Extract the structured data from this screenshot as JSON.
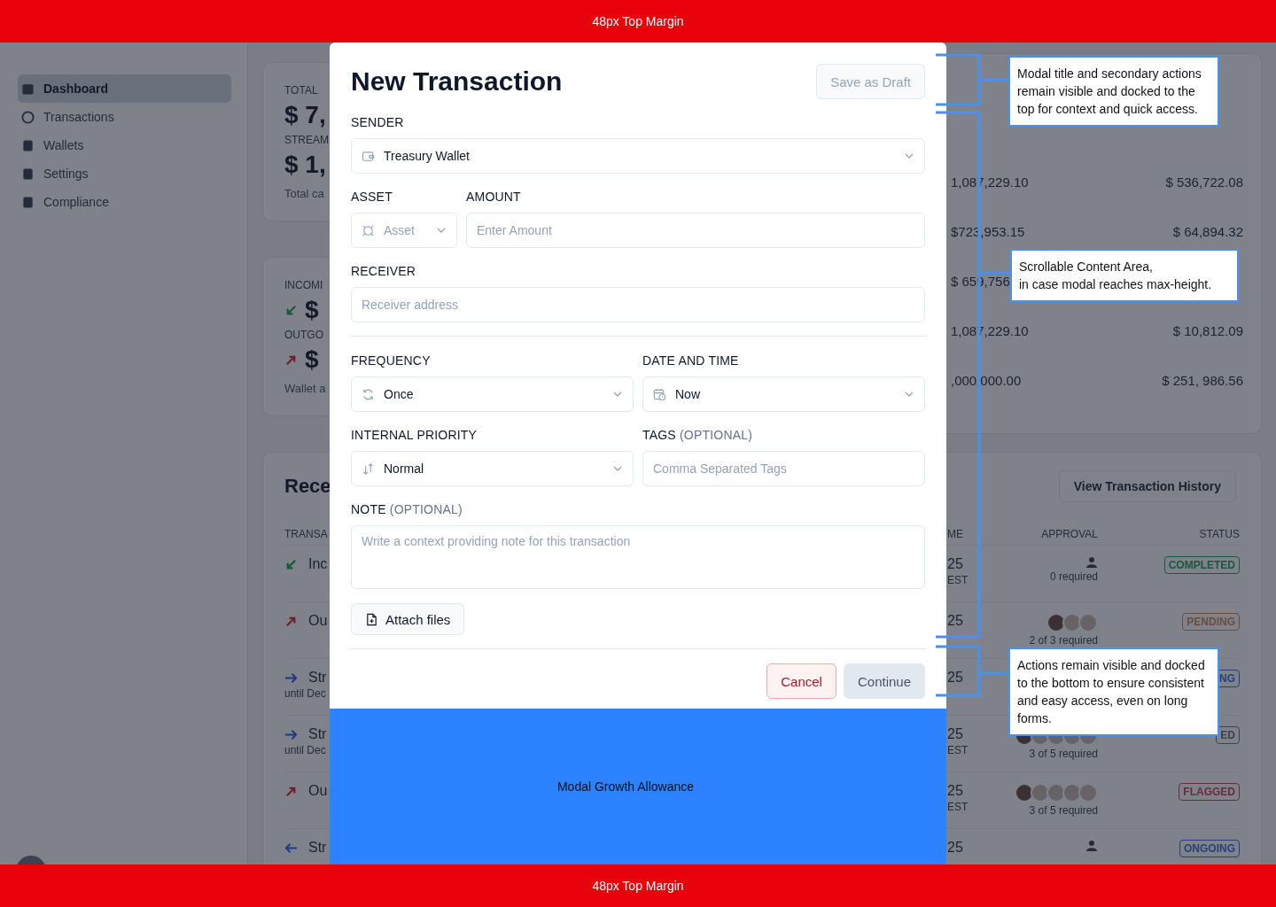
{
  "margins": {
    "top": {
      "label": "48px Top Margin"
    },
    "bottom": {
      "label": "48px Top Margin"
    }
  },
  "background": {
    "sidebar": {
      "items": [
        {
          "label": "Dashboard",
          "kind": "calendar",
          "selected": true
        },
        {
          "label": "Transactions",
          "kind": "coin",
          "selected": false
        },
        {
          "label": "Wallets",
          "kind": "document",
          "selected": false
        },
        {
          "label": "Settings",
          "kind": "document",
          "selected": false
        },
        {
          "label": "Compliance",
          "kind": "document",
          "selected": false
        }
      ]
    },
    "summary_card": {
      "lines": [
        {
          "kind": "label",
          "text": "TOTAL"
        },
        {
          "kind": "amount",
          "text": "$ 7,"
        },
        {
          "kind": "label",
          "text": "STREAM"
        },
        {
          "kind": "amount",
          "text": "$ 1,"
        },
        {
          "kind": "note",
          "text": "Total ca"
        }
      ]
    },
    "flow_card": {
      "lines": [
        {
          "kind": "label",
          "text": "INCOMI"
        },
        {
          "kind": "amount_in",
          "text": "$"
        },
        {
          "kind": "label",
          "text": "OUTGO"
        },
        {
          "kind": "amount_out",
          "text": "$"
        },
        {
          "kind": "note",
          "text": "Wallet a"
        }
      ]
    },
    "balance_table": {
      "rows": [
        {
          "balance": "1,087,229.10",
          "streaming": "$ 536,722.08"
        },
        {
          "balance": "$723,953.15",
          "streaming": "$ 64,894.32"
        },
        {
          "balance": "$ 659,756"
        },
        {
          "balance": "1,087,229.10",
          "streaming": "$ 10,812.09"
        },
        {
          "balance": ",000,000.00",
          "streaming": "$ 251, 986.56"
        }
      ]
    },
    "recent_card": {
      "title": "Rece",
      "history_button": "View Transaction History",
      "columns": [
        "TRANSA",
        "ME",
        "APPROVAL",
        "STATUS"
      ],
      "rows": [
        {
          "kind": "in",
          "name": "Inc",
          "time": "25",
          "zone": "EST",
          "approval": {
            "kind": "person",
            "text": "0 required"
          },
          "status": {
            "label": "COMPLETED",
            "kind": "success"
          }
        },
        {
          "kind": "out",
          "name": "Ou",
          "time": "25",
          "approval": {
            "kind": "avatars",
            "avatars": [
              {
                "kind": "dark"
              },
              {
                "kind": "light"
              },
              {
                "kind": "light"
              }
            ],
            "text": "2 of 3 required"
          },
          "status": {
            "label": "PENDING",
            "kind": "warning"
          }
        },
        {
          "kind": "stream",
          "name": "Str",
          "sub": "until Dec",
          "time": "25",
          "status": {
            "label": "NG",
            "kind": "info"
          }
        },
        {
          "kind": "stream",
          "name": "Str",
          "sub": "until Dec",
          "time": "25",
          "zone": "EST",
          "approval": {
            "kind": "avatars",
            "avatars": [
              {
                "kind": "dark"
              },
              {
                "kind": "light"
              },
              {
                "kind": "light"
              },
              {
                "kind": "light"
              },
              {
                "kind": "light"
              }
            ],
            "text": "3 of 5 required"
          },
          "status": {
            "label": "ED",
            "kind": "neutral"
          }
        },
        {
          "kind": "out",
          "name": "Ou",
          "time": "25",
          "zone": "EST",
          "approval": {
            "kind": "avatars",
            "avatars": [
              {
                "kind": "dark"
              },
              {
                "kind": "light"
              },
              {
                "kind": "light"
              },
              {
                "kind": "light"
              },
              {
                "kind": "light"
              }
            ],
            "text": "3 of 5 required"
          },
          "status": {
            "label": "FLAGGED",
            "kind": "danger"
          }
        },
        {
          "kind": "stream_back",
          "name": "Str",
          "time": "25",
          "approval": {
            "kind": "person"
          },
          "status": {
            "label": "ONGOING",
            "kind": "info"
          }
        }
      ]
    }
  },
  "modal": {
    "title": "New Transaction",
    "draft_button": {
      "label": "Save as Draft",
      "disabled": true
    },
    "sender": {
      "label": "SENDER",
      "value": "Treasury Wallet"
    },
    "asset": {
      "label": "ASSET",
      "placeholder": "Asset"
    },
    "amount": {
      "label": "AMOUNT",
      "placeholder": "Enter Amount"
    },
    "receiver": {
      "label": "RECEIVER",
      "placeholder": "Receiver address"
    },
    "frequency": {
      "label": "FREQUENCY",
      "value": "Once"
    },
    "datetime": {
      "label": "DATE AND TIME",
      "value": "Now"
    },
    "priority": {
      "label": "INTERNAL PRIORITY",
      "value": "Normal"
    },
    "tags": {
      "label": "TAGS",
      "optional": "(OPTIONAL)",
      "placeholder": "Comma Separated Tags"
    },
    "note": {
      "label": "NOTE",
      "optional": "(OPTIONAL)",
      "placeholder": "Write a context providing note for this transaction"
    },
    "attach_button": "Attach files",
    "cancel_button": "Cancel",
    "continue_button": {
      "label": "Continue",
      "disabled": true
    }
  },
  "allowance": {
    "label": "Modal Growth Allowance"
  },
  "annotations": [
    {
      "text": "Modal title and secondary actions remain visible and docked to the top for context and quick access."
    },
    {
      "text": "Scrollable Content Area,\nin case modal reaches max-height."
    },
    {
      "text": "Actions remain visible and docked to the bottom to ensure consistent and easy access, even on long forms."
    }
  ]
}
